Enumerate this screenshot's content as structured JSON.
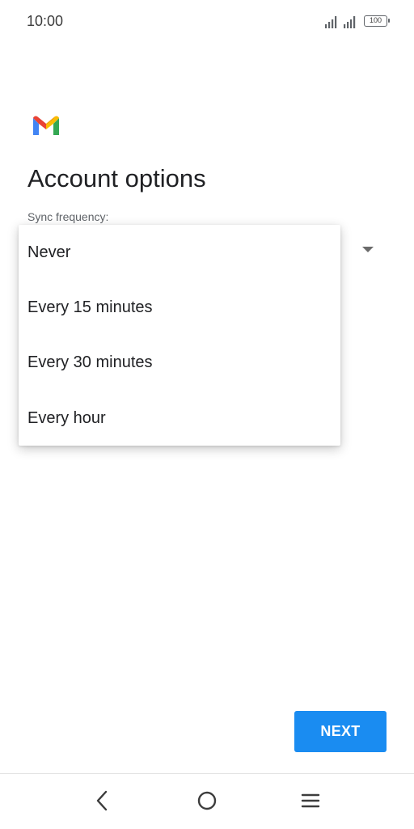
{
  "status_bar": {
    "time": "10:00",
    "battery_level": "100",
    "icons": [
      "signal-icon",
      "signal-icon",
      "battery-icon"
    ]
  },
  "app": {
    "logo_icon": "gmail-logo-icon"
  },
  "page": {
    "title": "Account options",
    "sync_label": "Sync frequency:"
  },
  "sync_dropdown": {
    "options": [
      "Never",
      "Every 15 minutes",
      "Every 30 minutes",
      "Every hour"
    ]
  },
  "actions": {
    "next_label": "NEXT"
  },
  "nav_bar": {
    "icons": [
      "back-icon",
      "home-icon",
      "menu-icon"
    ]
  },
  "colors": {
    "accent": "#1a8cf1",
    "text_primary": "#202124",
    "text_secondary": "#5f6368"
  }
}
